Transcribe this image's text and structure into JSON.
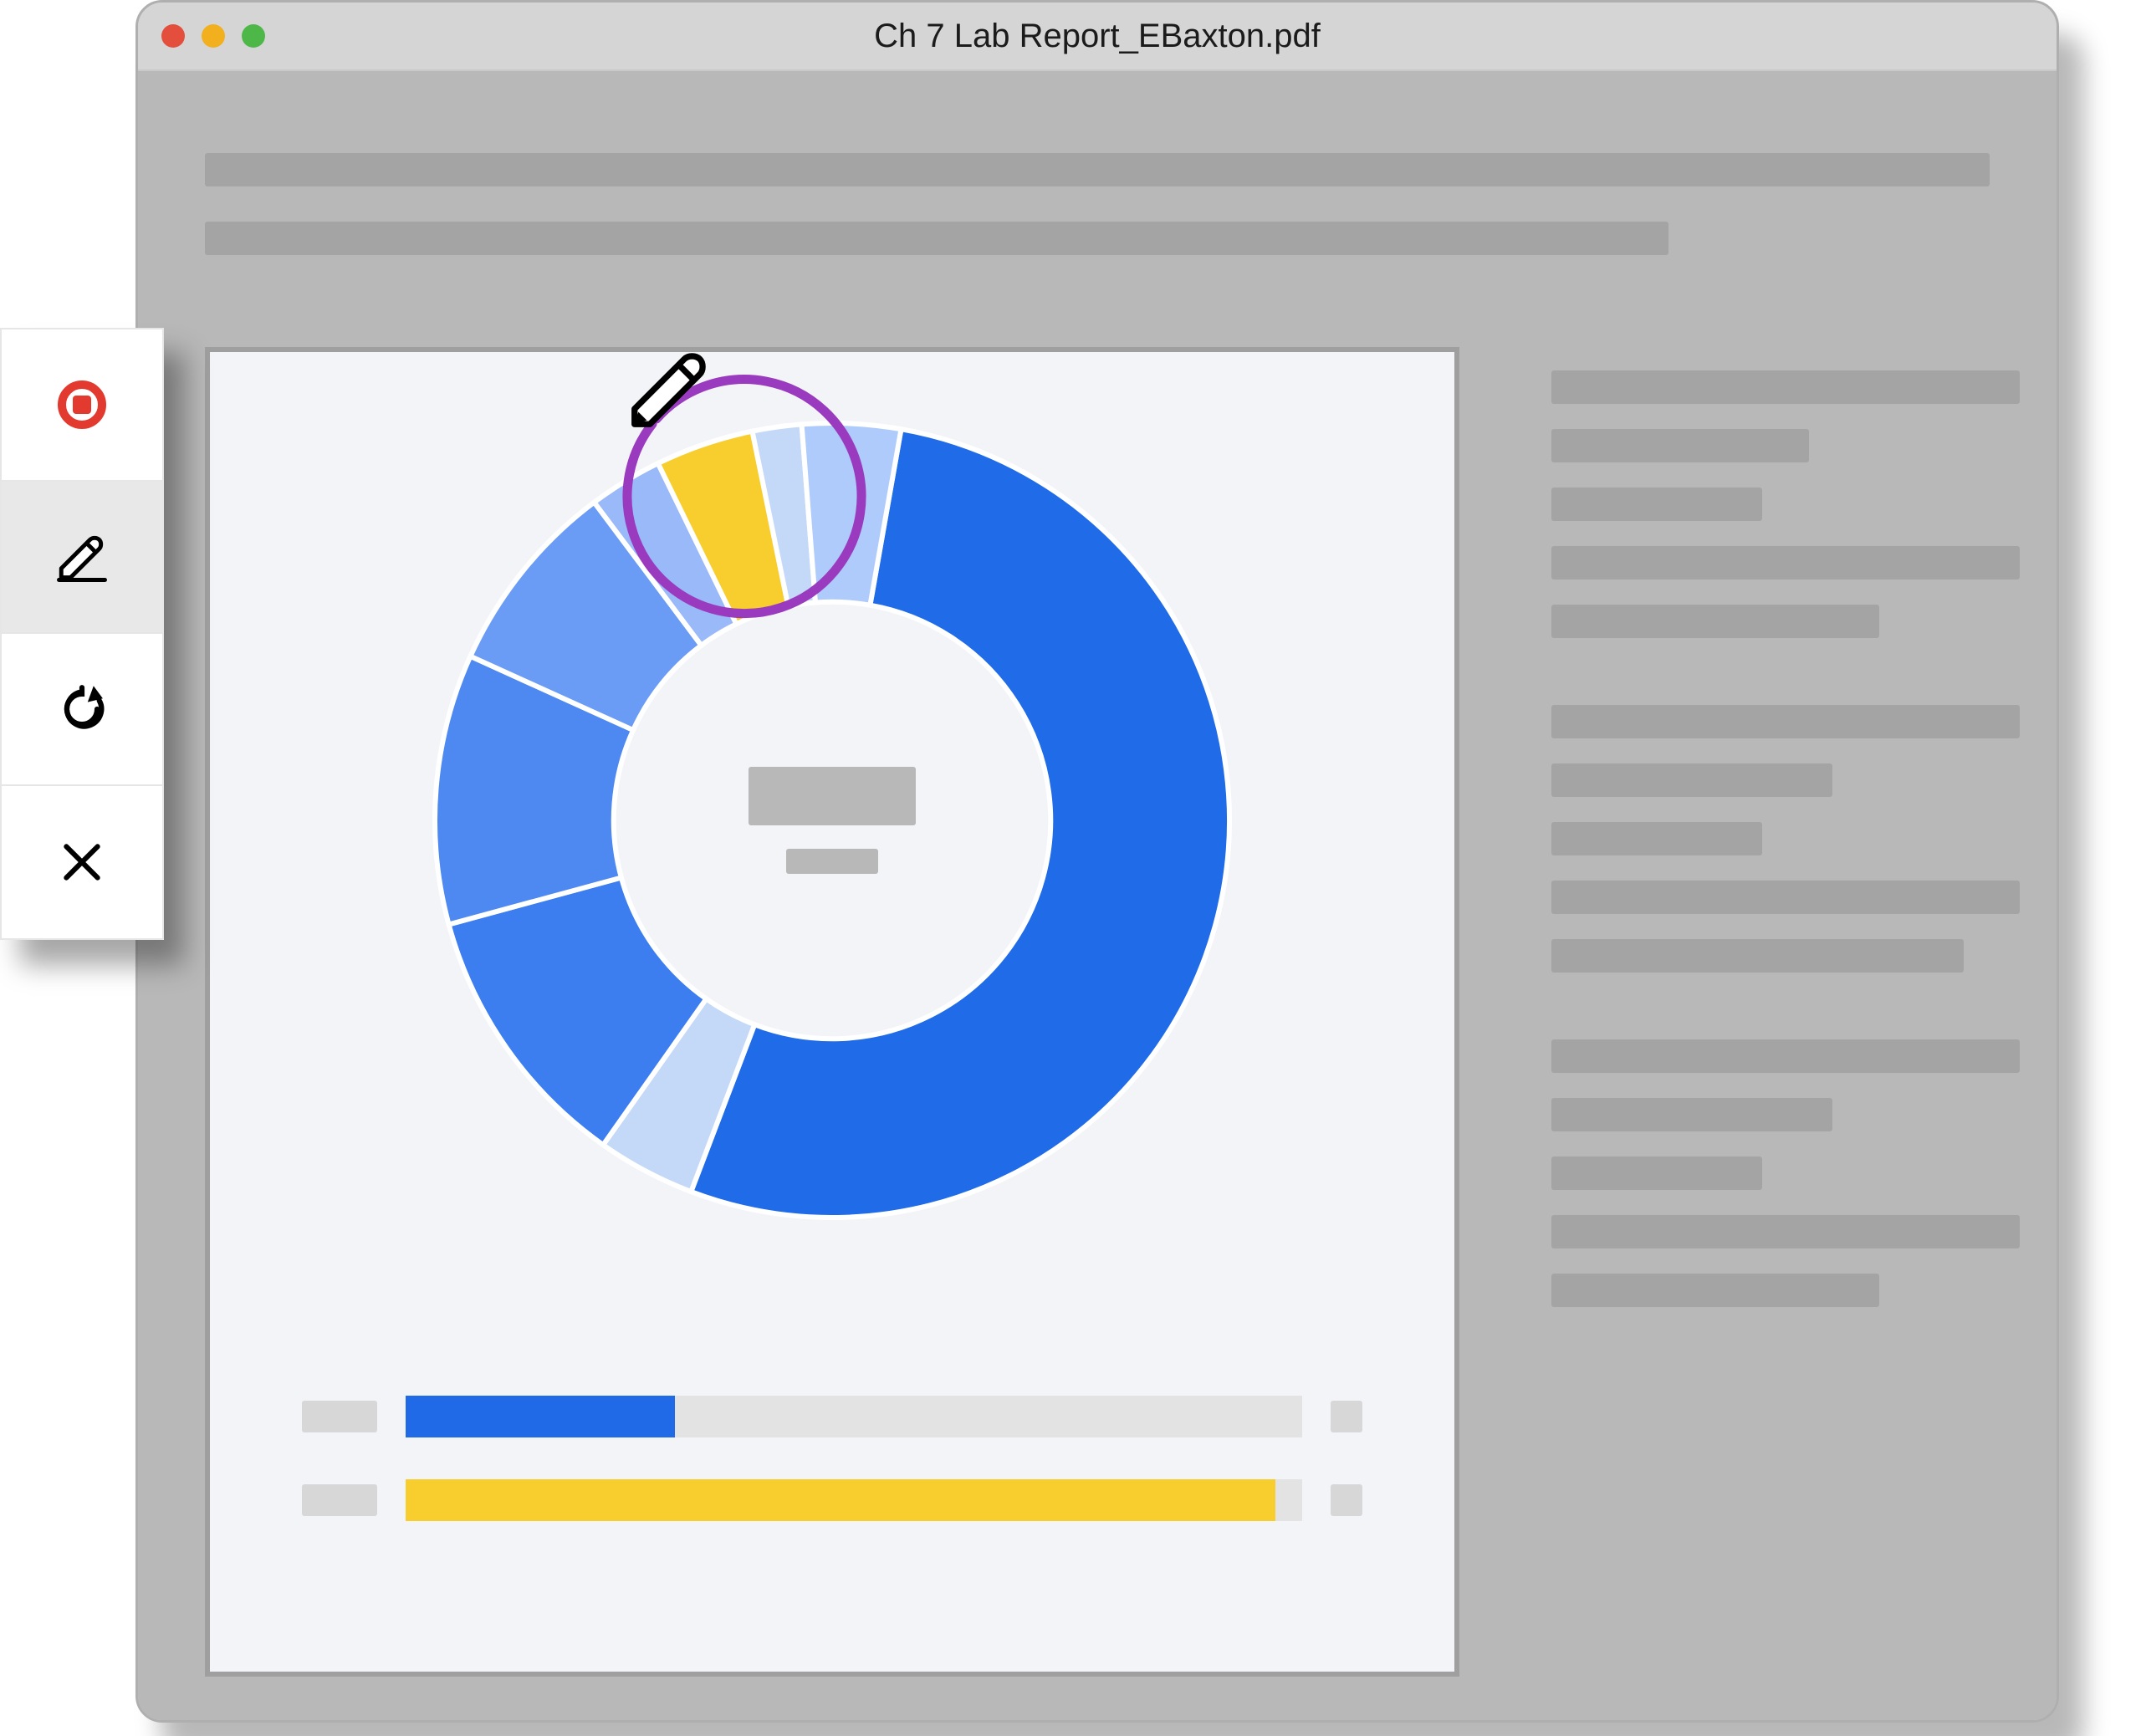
{
  "window": {
    "title": "Ch 7 Lab Report_EBaxton.pdf",
    "traffic": {
      "red": "#E34F3C",
      "yellow": "#F2B01E",
      "green": "#4DB748"
    }
  },
  "toolbar": {
    "items": [
      {
        "name": "record-stop",
        "icon": "record-stop-icon"
      },
      {
        "name": "draw-pencil",
        "icon": "pencil-icon",
        "active": true
      },
      {
        "name": "redo",
        "icon": "redo-icon"
      },
      {
        "name": "close",
        "icon": "close-icon"
      }
    ]
  },
  "annotation": {
    "color": "#9A3BBF",
    "tool_icon": "pencil-icon"
  },
  "progress": [
    {
      "color": "blue",
      "percent": 30
    },
    {
      "color": "yellow",
      "percent": 97
    }
  ],
  "chart_data": {
    "type": "pie",
    "title": "",
    "series": [
      {
        "name": "segment-1",
        "value": 53,
        "color": "#1F6BE8"
      },
      {
        "name": "segment-2",
        "value": 4,
        "color": "#C4D8F8"
      },
      {
        "name": "segment-3",
        "value": 11,
        "color": "#3C7DF0"
      },
      {
        "name": "segment-4",
        "value": 11,
        "color": "#4E89F2"
      },
      {
        "name": "segment-5",
        "value": 8,
        "color": "#6A9CF5"
      },
      {
        "name": "segment-6",
        "value": 3,
        "color": "#9AB9F8"
      },
      {
        "name": "segment-7",
        "value": 4,
        "color": "#F8CE2E"
      },
      {
        "name": "segment-8",
        "value": 2,
        "color": "#C4D8F8"
      },
      {
        "name": "segment-9",
        "value": 4,
        "color": "#AECBFB"
      }
    ],
    "inner_radius_ratio": 0.55
  }
}
